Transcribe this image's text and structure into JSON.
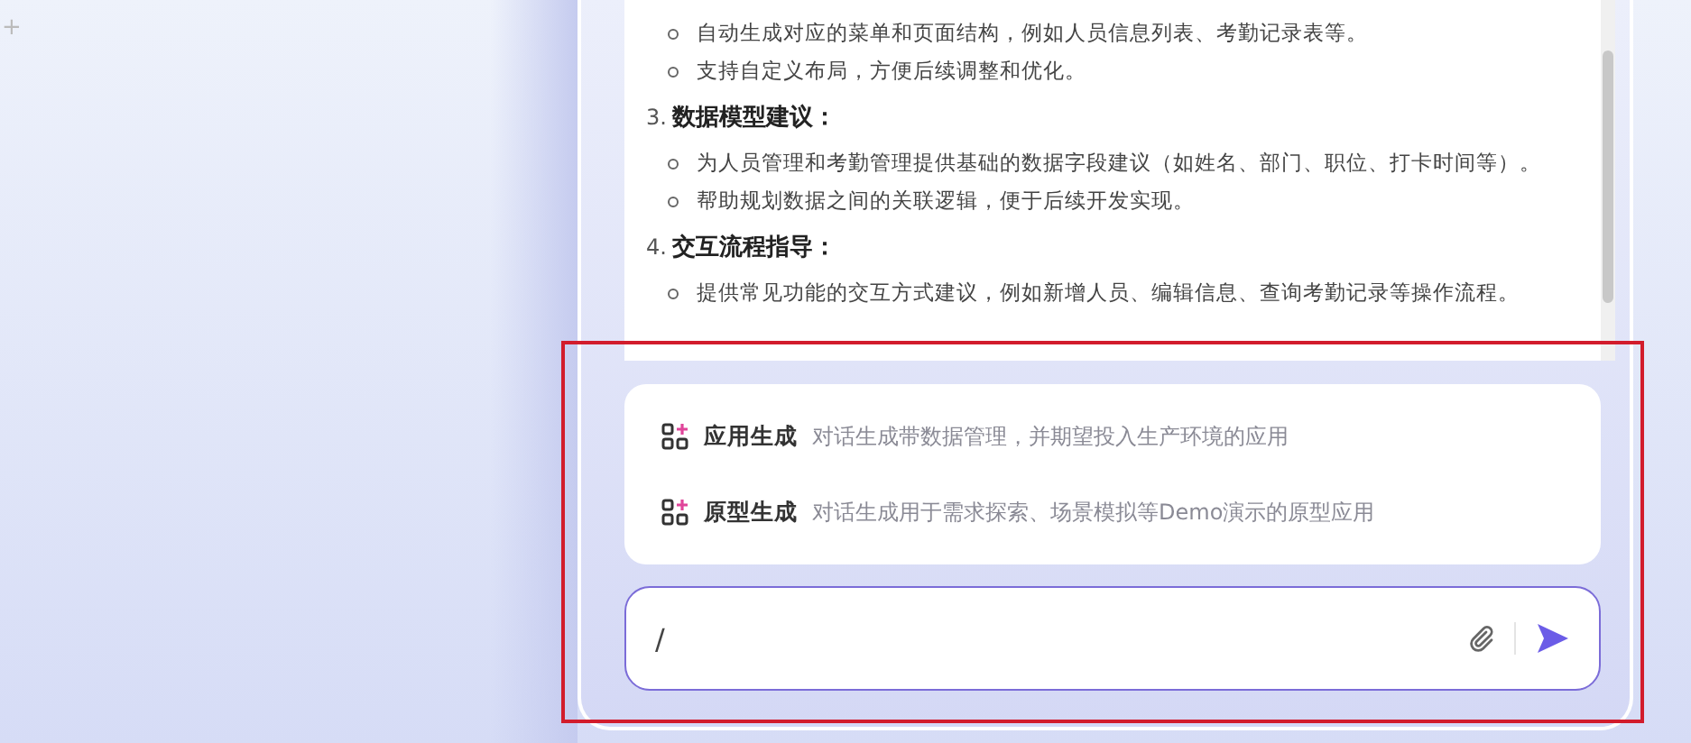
{
  "corner_mark": "+",
  "message": {
    "blocks": [
      {
        "kind": "bullet",
        "text": "自动生成对应的菜单和页面结构，例如人员信息列表、考勤记录表等。"
      },
      {
        "kind": "bullet",
        "text": "支持自定义布局，方便后续调整和优化。"
      },
      {
        "kind": "heading",
        "number": "3.",
        "text": "数据模型建议："
      },
      {
        "kind": "bullet",
        "text": "为人员管理和考勤管理提供基础的数据字段建议（如姓名、部门、职位、打卡时间等）。"
      },
      {
        "kind": "bullet",
        "text": "帮助规划数据之间的关联逻辑，便于后续开发实现。"
      },
      {
        "kind": "heading",
        "number": "4.",
        "text": "交互流程指导："
      },
      {
        "kind": "bullet",
        "text": "提供常见功能的交互方式建议，例如新增人员、编辑信息、查询考勤记录等操作流程。"
      }
    ]
  },
  "suggestions": [
    {
      "title": "应用生成",
      "description": "对话生成带数据管理，并期望投入生产环境的应用"
    },
    {
      "title": "原型生成",
      "description": "对话生成用于需求探索、场景模拟等Demo演示的原型应用"
    }
  ],
  "input": {
    "value": "/"
  }
}
